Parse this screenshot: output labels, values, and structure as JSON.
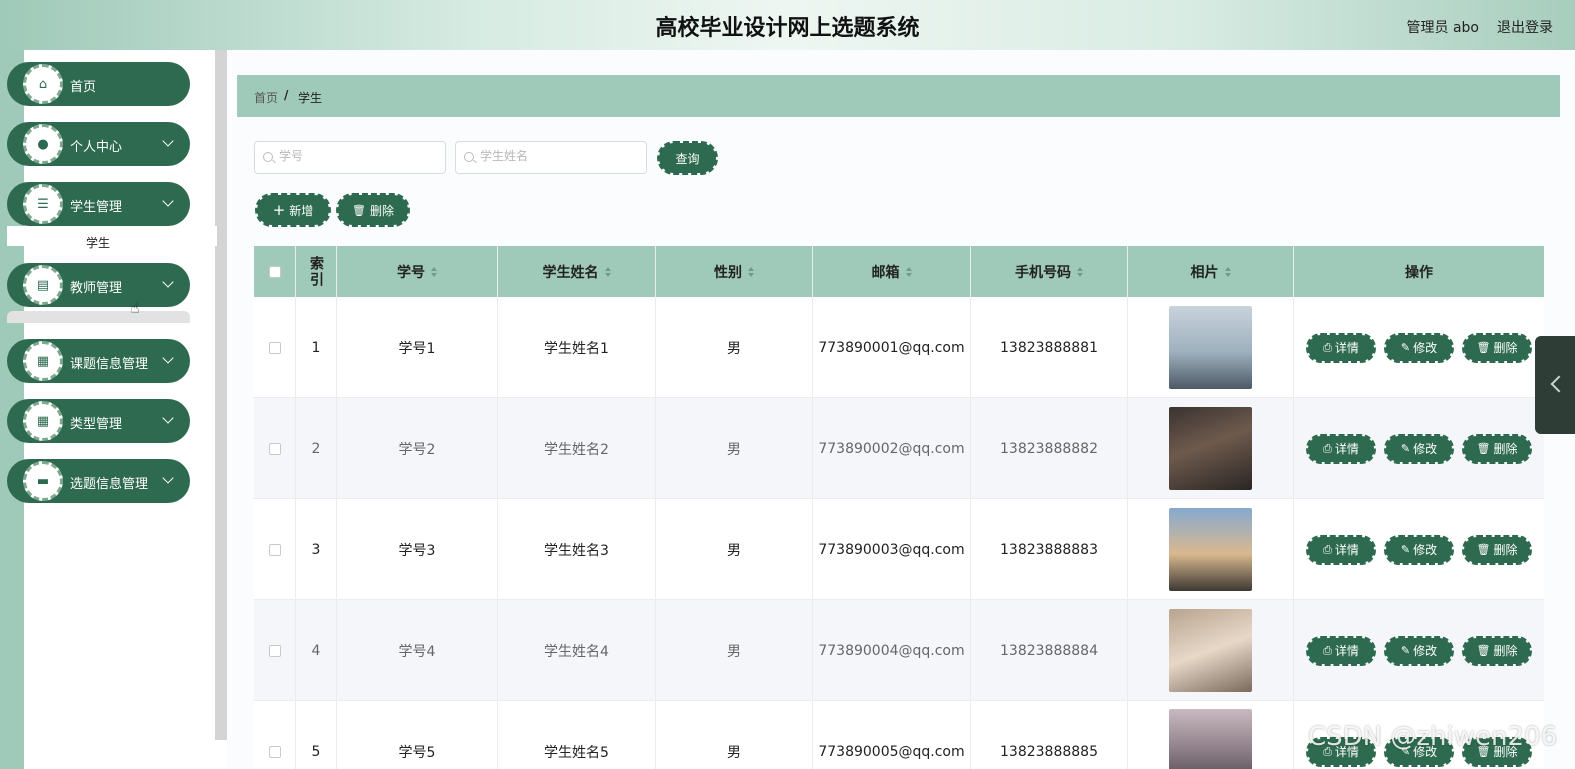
{
  "header": {
    "title": "高校毕业设计网上选题系统",
    "user": "管理员 abo",
    "logout": "退出登录"
  },
  "sidebar": {
    "items": [
      {
        "label": "首页",
        "icon": "home-icon",
        "glyph": "⌂",
        "expandable": false
      },
      {
        "label": "个人中心",
        "icon": "user-icon",
        "glyph": "●",
        "expandable": true
      },
      {
        "label": "学生管理",
        "icon": "list-icon",
        "glyph": "☰",
        "expandable": true
      },
      {
        "label": "教师管理",
        "icon": "clipboard-icon",
        "glyph": "▤",
        "expandable": true
      },
      {
        "label": "课题信息管理",
        "icon": "grid-icon",
        "glyph": "▦",
        "expandable": true
      },
      {
        "label": "类型管理",
        "icon": "grid-icon",
        "glyph": "▦",
        "expandable": true
      },
      {
        "label": "选题信息管理",
        "icon": "briefcase-icon",
        "glyph": "▬",
        "expandable": true
      }
    ],
    "submenu_peek": "学生"
  },
  "breadcrumb": {
    "home": "首页",
    "separator": "/",
    "current": "学生"
  },
  "search": {
    "student_no_placeholder": "学号",
    "student_name_placeholder": "学生姓名",
    "query_label": "查询"
  },
  "toolbar": {
    "add_label": "新增",
    "delete_label": "删除"
  },
  "table": {
    "columns": [
      "索引",
      "学号",
      "学生姓名",
      "性别",
      "邮箱",
      "手机号码",
      "相片",
      "操作"
    ],
    "rows": [
      {
        "index": "1",
        "student_no": "学号1",
        "name": "学生姓名1",
        "gender": "男",
        "email": "773890001@qq.com",
        "phone": "13823888881"
      },
      {
        "index": "2",
        "student_no": "学号2",
        "name": "学生姓名2",
        "gender": "男",
        "email": "773890002@qq.com",
        "phone": "13823888882"
      },
      {
        "index": "3",
        "student_no": "学号3",
        "name": "学生姓名3",
        "gender": "男",
        "email": "773890003@qq.com",
        "phone": "13823888883"
      },
      {
        "index": "4",
        "student_no": "学号4",
        "name": "学生姓名4",
        "gender": "男",
        "email": "773890004@qq.com",
        "phone": "13823888884"
      },
      {
        "index": "5",
        "student_no": "学号5",
        "name": "学生姓名5",
        "gender": "男",
        "email": "773890005@qq.com",
        "phone": "13823888885"
      }
    ],
    "actions": {
      "detail": "详情",
      "edit": "修改",
      "delete": "删除"
    }
  },
  "watermark": "CSDN @zhiwen206",
  "colors": {
    "accent": "#2d6a4f",
    "header_band": "#9fc9b8"
  }
}
